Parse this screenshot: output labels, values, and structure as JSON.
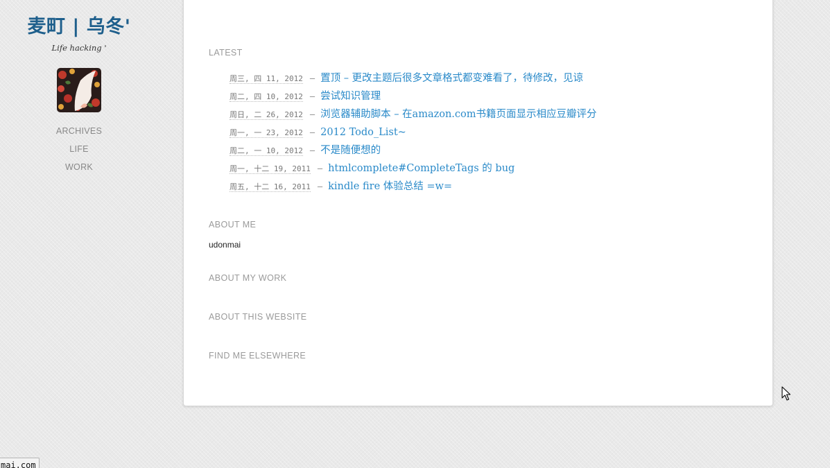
{
  "site": {
    "title": "麦町 | 乌冬'",
    "tagline": "Life hacking '"
  },
  "nav": [
    {
      "label": "ARCHIVES"
    },
    {
      "label": "LIFE"
    },
    {
      "label": "WORK"
    }
  ],
  "main": {
    "latest_heading": "LATEST",
    "posts": [
      {
        "date": "周三, 四 11, 2012",
        "title": "置顶 – 更改主题后很多文章格式都变难看了，待修改，见谅"
      },
      {
        "date": "周二, 四 10, 2012",
        "title": "尝试知识管理"
      },
      {
        "date": "周日, 二 26, 2012",
        "title": "浏览器辅助脚本 – 在amazon.com书籍页面显示相应豆瓣评分"
      },
      {
        "date": "周一, 一 23, 2012",
        "title": "2012 Todo_List~"
      },
      {
        "date": "周二, 一 10, 2012",
        "title": "不是随便想的"
      },
      {
        "date": "周一, 十二 19, 2011",
        "title": "htmlcomplete#CompleteTags 的 bug"
      },
      {
        "date": "周五, 十二 16, 2011",
        "title": "kindle fire 体验总结 =w="
      }
    ],
    "post_separator": "–",
    "about_me_heading": "ABOUT ME",
    "about_me_text": "udonmai",
    "about_work_heading": "ABOUT MY WORK",
    "about_website_heading": "ABOUT THIS WEBSITE",
    "find_me_heading": "FIND ME ELSEWHERE"
  },
  "status_bar": {
    "text": "mai.com"
  },
  "colors": {
    "title": "#1e5f8c",
    "link": "#2a8ac9",
    "heading": "#9a9a9a",
    "nav": "#888888",
    "background": "#e9e9e9",
    "panel": "#ffffff"
  },
  "icons": {
    "avatar": "avatar-image",
    "cursor": "mouse-pointer-icon"
  }
}
